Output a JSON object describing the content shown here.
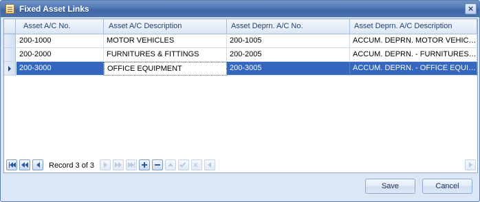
{
  "window": {
    "title": "Fixed Asset Links"
  },
  "grid": {
    "columns": [
      "Asset A/C No.",
      "Asset A/C Description",
      "Asset Deprn. A/C No.",
      "Asset Deprn. A/C Description"
    ],
    "rows": [
      [
        "200-1000",
        "MOTOR VEHICLES",
        "200-1005",
        "ACCUM. DEPRN. MOTOR VEHICLES"
      ],
      [
        "200-2000",
        "FURNITURES & FITTINGS",
        "200-2005",
        "ACCUM. DEPRN. - FURNITURES & FITTINGS"
      ],
      [
        "200-3000",
        "OFFICE EQUIPMENT",
        "200-3005",
        "ACCUM. DEPRN. - OFFICE EQUIPMENT"
      ]
    ],
    "selected_row": 3
  },
  "navigator": {
    "record_text": "Record 3 of 3"
  },
  "buttons": {
    "save": "Save",
    "cancel": "Cancel"
  },
  "colors": {
    "titlebar": "#4f78b4",
    "selection": "#3567be",
    "dialog_background": "#dbe7f6"
  }
}
